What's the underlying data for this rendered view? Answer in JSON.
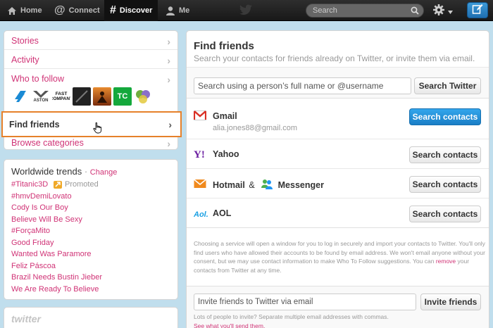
{
  "topbar": {
    "nav": [
      {
        "label": "Home",
        "icon": "home-icon"
      },
      {
        "label": "Connect",
        "icon": "at-icon"
      },
      {
        "label": "Discover",
        "icon": "hash-icon"
      },
      {
        "label": "Me",
        "icon": "person-icon"
      }
    ],
    "search_placeholder": "Search",
    "active": "Discover"
  },
  "sidebar": {
    "items": [
      {
        "label": "Stories"
      },
      {
        "label": "Activity"
      },
      {
        "label": "Who to follow"
      },
      {
        "label": "Find friends"
      },
      {
        "label": "Browse categories"
      }
    ],
    "who_to_follow_thumbs": [
      {
        "text": "",
        "color": "#1a8ad4"
      },
      {
        "text": "ASTON",
        "color": "#ffffff"
      },
      {
        "text": "FAST COMPANY",
        "color": "#ffffff"
      },
      {
        "text": "",
        "color": "#222222"
      },
      {
        "text": "",
        "color": "#c9541a"
      },
      {
        "text": "TC",
        "color": "#14a83c"
      },
      {
        "text": "",
        "color": "#6fae3f"
      }
    ]
  },
  "trends": {
    "title": "Worldwide trends",
    "change_label": "Change",
    "promoted_label": "Promoted",
    "items": [
      "#Titanic3D",
      "#hmvDemiLovato",
      "Cody Is Our Boy",
      "Believe Will Be Sexy",
      "#ForçaMito",
      "Good Friday",
      "Wanted Was Paramore",
      "Feliz Páscoa",
      "Brazil Needs Bustin Jieber",
      "We Are Ready To Believe"
    ]
  },
  "footer": {
    "logo_text": "twitter"
  },
  "main": {
    "title": "Find friends",
    "subtitle": "Search your contacts for friends already on Twitter, or invite them via email.",
    "search_placeholder": "Search using a person’s full name or @username",
    "search_button": "Search Twitter",
    "services": [
      {
        "name": "Gmail",
        "email": "alia.jones88@gmail.com",
        "button": "Search contacts",
        "primary": true
      },
      {
        "name": "Yahoo",
        "button": "Search contacts"
      },
      {
        "name": "Hotmail",
        "amp": "&",
        "name2": "Messenger",
        "button": "Search contacts"
      },
      {
        "name": "AOL",
        "button": "Search contacts"
      }
    ],
    "disclaimer": {
      "part1": "Choosing a service will open a window for you to log in securely and import your contacts to Twitter. You'll only find users who have allowed their accounts to be found by email address. We won't email anyone without your consent, but we may use contact information to make Who To Follow suggestions. You can ",
      "link": "remove",
      "part2": " your contacts from Twitter at any time."
    },
    "invite": {
      "placeholder": "Invite friends to Twitter via email",
      "button": "Invite friends",
      "note": "Lots of people to invite? Separate multiple email addresses with commas.",
      "link": "See what you'll send them."
    }
  },
  "colors": {
    "accent": "#d03376",
    "highlight": "#e6812a",
    "primary_button": "#2a95dc"
  }
}
